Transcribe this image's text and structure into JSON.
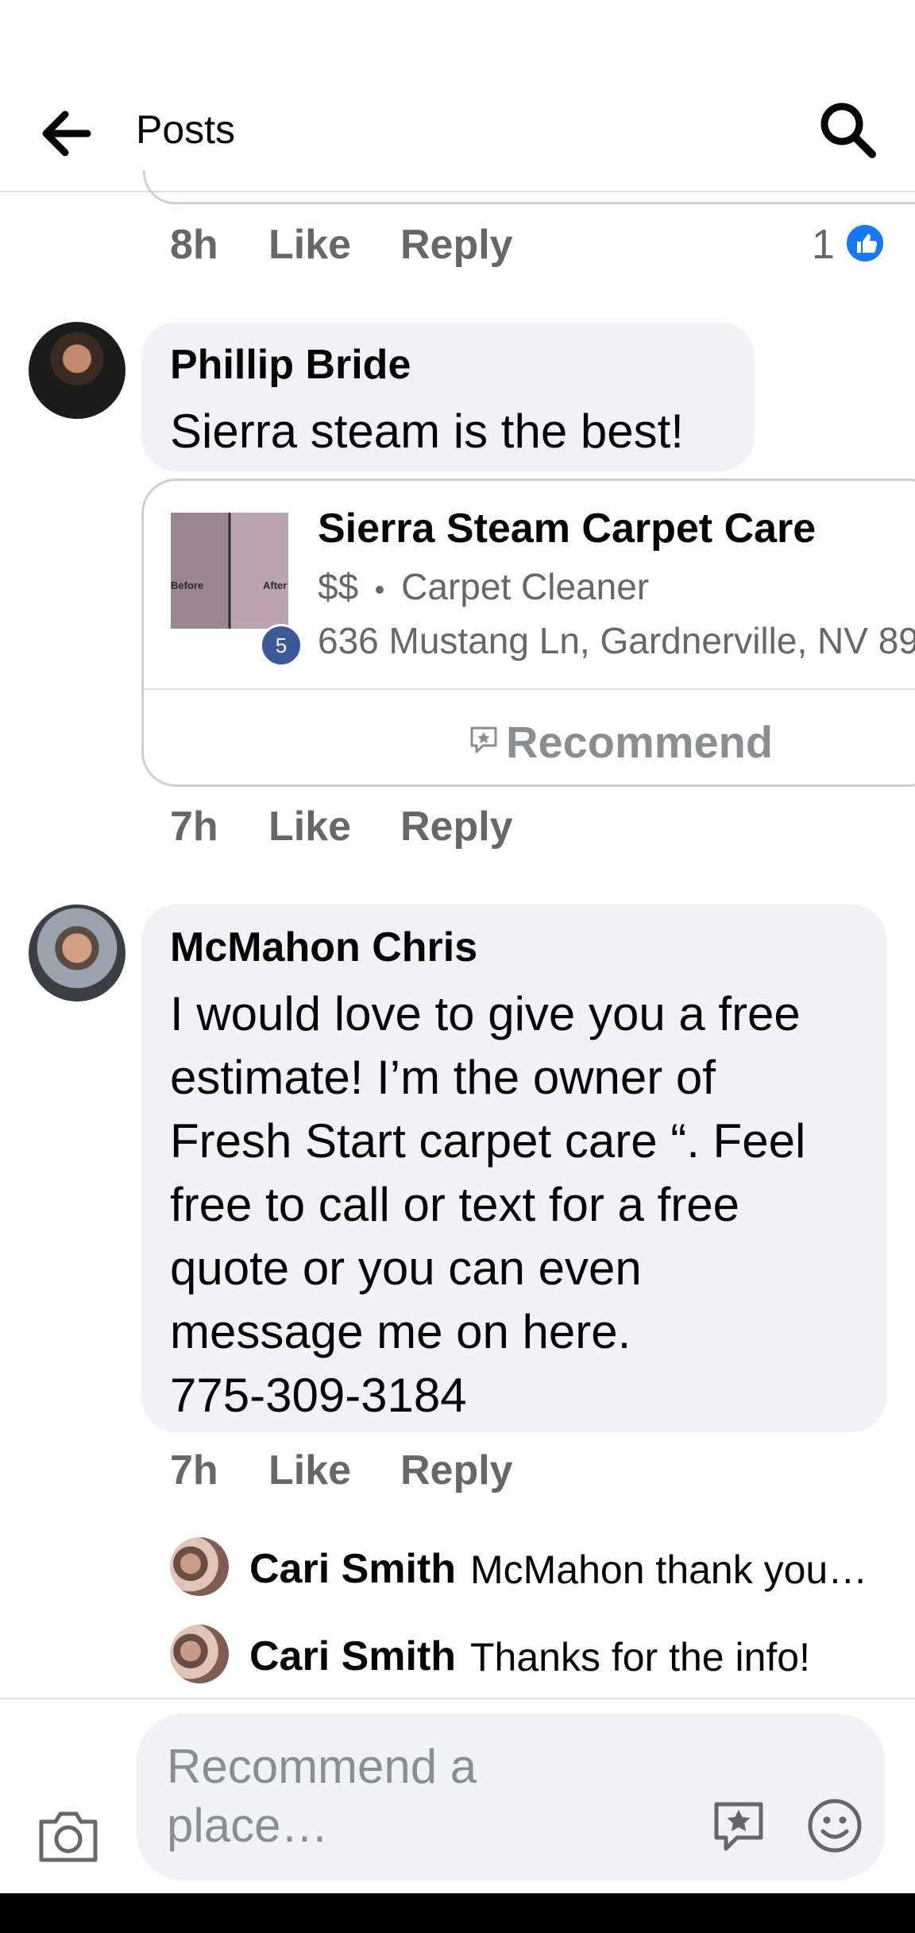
{
  "header": {
    "title": "Posts",
    "back_icon": "arrow-left-icon",
    "search_icon": "search-icon"
  },
  "previous_comment": {
    "time": "8h",
    "like_label": "Like",
    "reply_label": "Reply",
    "reaction_count": "1",
    "reaction_icon": "thumbs-up-icon"
  },
  "comments": [
    {
      "author": "Phillip Bride",
      "text": "Sierra steam is the best!",
      "place": {
        "name": "Sierra Steam Carpet Care",
        "price": "$$",
        "category": "Carpet Cleaner",
        "address": "636 Mustang Ln, Gardnerville, NV 89",
        "rating_badge": "5",
        "thumb_before": "Before",
        "thumb_after": "After",
        "recommend_label": "Recommend"
      },
      "time": "7h",
      "like_label": "Like",
      "reply_label": "Reply"
    },
    {
      "author": "McMahon Chris",
      "text": "I would love to give you a free\nestimate! I’m the owner of\nFresh Start carpet care “.  Feel\nfree to call or text for a free\nquote or you can even\nmessage me on here.\n775-309-3184",
      "time": "7h",
      "like_label": "Like",
      "reply_label": "Reply",
      "replies": [
        {
          "author": "Cari Smith",
          "text": "McMahon thank you…"
        },
        {
          "author": "Cari Smith",
          "text": "Thanks for the info!"
        }
      ]
    }
  ],
  "composer": {
    "placeholder": "Recommend a place…",
    "camera_icon": "camera-icon",
    "recommend_icon": "recommend-place-icon",
    "emoji_icon": "emoji-icon"
  },
  "colors": {
    "bubble": "#f0f2f5",
    "secondary_text": "#65676b",
    "like_blue": "#1877f2",
    "badge_blue": "#3b5998"
  }
}
